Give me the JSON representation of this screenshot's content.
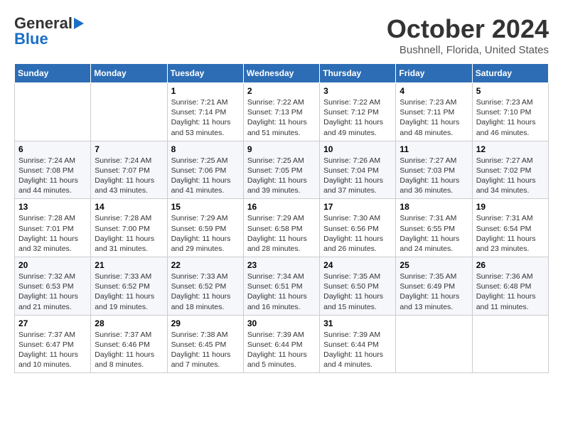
{
  "header": {
    "logo_line1": "General",
    "logo_line2": "Blue",
    "month": "October 2024",
    "location": "Bushnell, Florida, United States"
  },
  "weekdays": [
    "Sunday",
    "Monday",
    "Tuesday",
    "Wednesday",
    "Thursday",
    "Friday",
    "Saturday"
  ],
  "weeks": [
    [
      {
        "day": "",
        "info": ""
      },
      {
        "day": "",
        "info": ""
      },
      {
        "day": "1",
        "info": "Sunrise: 7:21 AM\nSunset: 7:14 PM\nDaylight: 11 hours and 53 minutes."
      },
      {
        "day": "2",
        "info": "Sunrise: 7:22 AM\nSunset: 7:13 PM\nDaylight: 11 hours and 51 minutes."
      },
      {
        "day": "3",
        "info": "Sunrise: 7:22 AM\nSunset: 7:12 PM\nDaylight: 11 hours and 49 minutes."
      },
      {
        "day": "4",
        "info": "Sunrise: 7:23 AM\nSunset: 7:11 PM\nDaylight: 11 hours and 48 minutes."
      },
      {
        "day": "5",
        "info": "Sunrise: 7:23 AM\nSunset: 7:10 PM\nDaylight: 11 hours and 46 minutes."
      }
    ],
    [
      {
        "day": "6",
        "info": "Sunrise: 7:24 AM\nSunset: 7:08 PM\nDaylight: 11 hours and 44 minutes."
      },
      {
        "day": "7",
        "info": "Sunrise: 7:24 AM\nSunset: 7:07 PM\nDaylight: 11 hours and 43 minutes."
      },
      {
        "day": "8",
        "info": "Sunrise: 7:25 AM\nSunset: 7:06 PM\nDaylight: 11 hours and 41 minutes."
      },
      {
        "day": "9",
        "info": "Sunrise: 7:25 AM\nSunset: 7:05 PM\nDaylight: 11 hours and 39 minutes."
      },
      {
        "day": "10",
        "info": "Sunrise: 7:26 AM\nSunset: 7:04 PM\nDaylight: 11 hours and 37 minutes."
      },
      {
        "day": "11",
        "info": "Sunrise: 7:27 AM\nSunset: 7:03 PM\nDaylight: 11 hours and 36 minutes."
      },
      {
        "day": "12",
        "info": "Sunrise: 7:27 AM\nSunset: 7:02 PM\nDaylight: 11 hours and 34 minutes."
      }
    ],
    [
      {
        "day": "13",
        "info": "Sunrise: 7:28 AM\nSunset: 7:01 PM\nDaylight: 11 hours and 32 minutes."
      },
      {
        "day": "14",
        "info": "Sunrise: 7:28 AM\nSunset: 7:00 PM\nDaylight: 11 hours and 31 minutes."
      },
      {
        "day": "15",
        "info": "Sunrise: 7:29 AM\nSunset: 6:59 PM\nDaylight: 11 hours and 29 minutes."
      },
      {
        "day": "16",
        "info": "Sunrise: 7:29 AM\nSunset: 6:58 PM\nDaylight: 11 hours and 28 minutes."
      },
      {
        "day": "17",
        "info": "Sunrise: 7:30 AM\nSunset: 6:56 PM\nDaylight: 11 hours and 26 minutes."
      },
      {
        "day": "18",
        "info": "Sunrise: 7:31 AM\nSunset: 6:55 PM\nDaylight: 11 hours and 24 minutes."
      },
      {
        "day": "19",
        "info": "Sunrise: 7:31 AM\nSunset: 6:54 PM\nDaylight: 11 hours and 23 minutes."
      }
    ],
    [
      {
        "day": "20",
        "info": "Sunrise: 7:32 AM\nSunset: 6:53 PM\nDaylight: 11 hours and 21 minutes."
      },
      {
        "day": "21",
        "info": "Sunrise: 7:33 AM\nSunset: 6:52 PM\nDaylight: 11 hours and 19 minutes."
      },
      {
        "day": "22",
        "info": "Sunrise: 7:33 AM\nSunset: 6:52 PM\nDaylight: 11 hours and 18 minutes."
      },
      {
        "day": "23",
        "info": "Sunrise: 7:34 AM\nSunset: 6:51 PM\nDaylight: 11 hours and 16 minutes."
      },
      {
        "day": "24",
        "info": "Sunrise: 7:35 AM\nSunset: 6:50 PM\nDaylight: 11 hours and 15 minutes."
      },
      {
        "day": "25",
        "info": "Sunrise: 7:35 AM\nSunset: 6:49 PM\nDaylight: 11 hours and 13 minutes."
      },
      {
        "day": "26",
        "info": "Sunrise: 7:36 AM\nSunset: 6:48 PM\nDaylight: 11 hours and 11 minutes."
      }
    ],
    [
      {
        "day": "27",
        "info": "Sunrise: 7:37 AM\nSunset: 6:47 PM\nDaylight: 11 hours and 10 minutes."
      },
      {
        "day": "28",
        "info": "Sunrise: 7:37 AM\nSunset: 6:46 PM\nDaylight: 11 hours and 8 minutes."
      },
      {
        "day": "29",
        "info": "Sunrise: 7:38 AM\nSunset: 6:45 PM\nDaylight: 11 hours and 7 minutes."
      },
      {
        "day": "30",
        "info": "Sunrise: 7:39 AM\nSunset: 6:44 PM\nDaylight: 11 hours and 5 minutes."
      },
      {
        "day": "31",
        "info": "Sunrise: 7:39 AM\nSunset: 6:44 PM\nDaylight: 11 hours and 4 minutes."
      },
      {
        "day": "",
        "info": ""
      },
      {
        "day": "",
        "info": ""
      }
    ]
  ]
}
